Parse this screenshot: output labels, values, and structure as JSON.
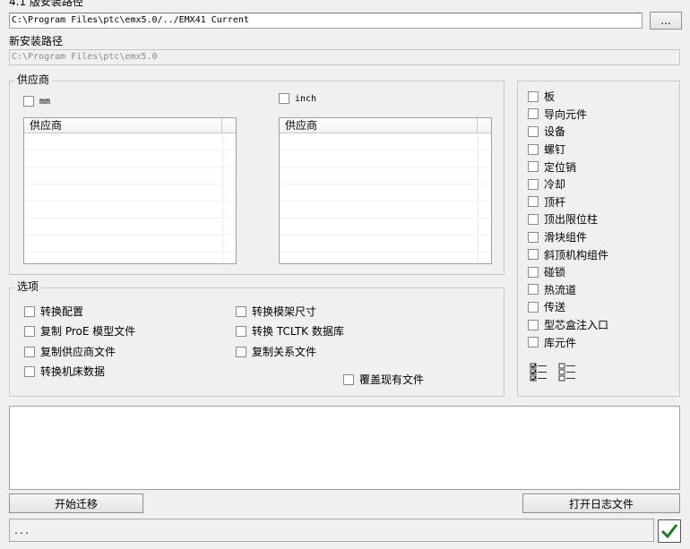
{
  "old_path": {
    "label": "4.1 版安装路径",
    "value": "C:\\Program Files\\ptc\\emx5.0/../EMX41 Current",
    "browse_label": "..."
  },
  "new_path": {
    "label": "新安装路径",
    "value": "C:\\Program Files\\ptc\\emx5.0"
  },
  "supplier_group": {
    "title": "供应商",
    "mm_label": "mm",
    "inch_label": "inch",
    "mm_list_header": "供应商",
    "inch_list_header": "供应商"
  },
  "components": [
    {
      "label": "板"
    },
    {
      "label": "导向元件"
    },
    {
      "label": "设备"
    },
    {
      "label": "螺钉"
    },
    {
      "label": "定位销"
    },
    {
      "label": "冷却"
    },
    {
      "label": "顶杆"
    },
    {
      "label": "顶出限位柱"
    },
    {
      "label": "滑块组件"
    },
    {
      "label": "斜顶机构组件"
    },
    {
      "label": "碰锁"
    },
    {
      "label": "热流道"
    },
    {
      "label": "传送"
    },
    {
      "label": "型芯盒注入口"
    },
    {
      "label": "库元件"
    }
  ],
  "options_group": {
    "title": "选项",
    "convert_config": "转换配置",
    "copy_proe_models": "复制 ProE 模型文件",
    "copy_supplier_files": "复制供应商文件",
    "convert_machine_data": "转换机床数据",
    "convert_frame_size": "转换模架尺寸",
    "convert_tcltk_db": "转换 TCLTK 数据库",
    "copy_relation_files": "复制关系文件",
    "overwrite_existing": "覆盖现有文件"
  },
  "actions": {
    "start_migration": "开始迁移",
    "open_log_file": "打开日志文件"
  },
  "status_bar": {
    "text": "..."
  }
}
